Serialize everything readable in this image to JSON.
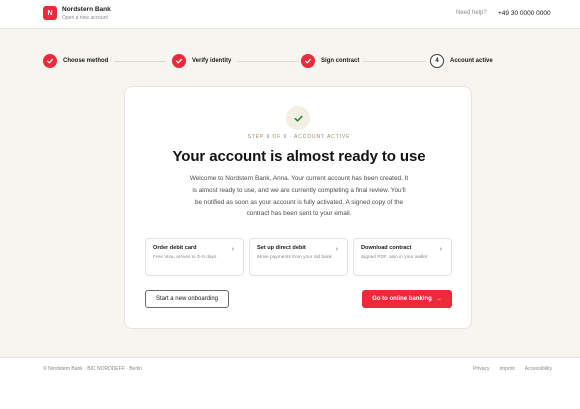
{
  "header": {
    "logo_letter": "N",
    "brand_name": "Nordstern Bank",
    "brand_sub": "Open a new account",
    "help_label": "Need help?",
    "phone": "+49 30 0000 0000"
  },
  "stepper": {
    "steps": [
      {
        "label": "Choose method",
        "status": "done"
      },
      {
        "label": "Verify identity",
        "status": "done"
      },
      {
        "label": "Sign contract",
        "status": "done"
      },
      {
        "label": "Account active",
        "status": "current",
        "number": "4"
      }
    ]
  },
  "card": {
    "eyebrow": "STEP 9 OF 9 · ACCOUNT ACTIVE",
    "title": "Your account is almost ready to use",
    "description": "Welcome to Nordstern Bank, Anna. Your current account has been created. It is almost ready to use, and we are currently completing a final review. You'll be notified as soon as your account is fully activated. A signed copy of the contract has been sent to your email.",
    "actions": [
      {
        "title": "Order debit card",
        "subtitle": "Free Visa, arrives in 3–5 days",
        "icon": "chevron-right-icon"
      },
      {
        "title": "Set up direct debit",
        "subtitle": "Move payments from your old bank",
        "icon": "chevron-right-icon"
      },
      {
        "title": "Download contract",
        "subtitle": "Signed PDF, also in your wallet",
        "icon": "chevron-right-icon"
      }
    ],
    "secondary_button": "Start a new onboarding",
    "primary_button": "Go to online banking",
    "primary_button_icon": "arrow-right-icon"
  },
  "footer": {
    "copyright": "© Nordstern Bank · BIC NORDDEFF · Berlin",
    "links": [
      "Privacy",
      "Imprint",
      "Accessibility"
    ]
  },
  "colors": {
    "accent": "#ee2a3a",
    "background": "#f6f5f0",
    "success": "#1e8a3a"
  }
}
